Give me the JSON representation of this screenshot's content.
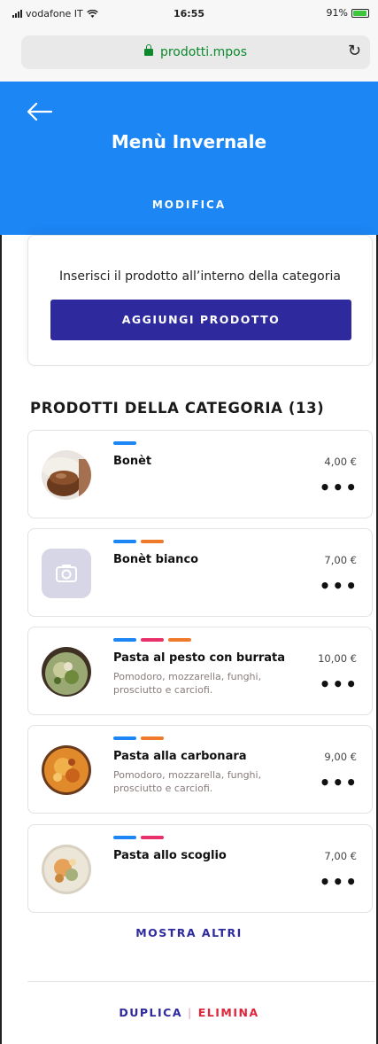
{
  "status_bar": {
    "carrier": "vodafone IT",
    "time": "16:55",
    "battery": "91%",
    "battery_level": 0.91,
    "colors": {
      "battery": "#3cc73c"
    }
  },
  "browser": {
    "url": "prodotti.mpos",
    "lock_icon": "lock-icon",
    "reload_icon": "reload-icon"
  },
  "header": {
    "title": "Menù Invernale",
    "modify_label": "MODIFICA",
    "back_icon": "back-arrow-icon",
    "background": "#1c86f5"
  },
  "add_card": {
    "text": "Inserisci il prodotto all’interno della categoria",
    "button_label": "AGGIUNGI PRODOTTO",
    "button_color": "#2e2a9e"
  },
  "products_section": {
    "title": "PRODOTTI DELLA CATEGORIA (13)"
  },
  "tag_colors": {
    "blue": "#1c86f5",
    "orange": "#f07a2c",
    "pink": "#e8306a"
  },
  "products": [
    {
      "name": "Bonèt",
      "price": "4,00 €",
      "description": "",
      "tags": [
        "blue"
      ],
      "image": "bonet-photo"
    },
    {
      "name": "Bonèt bianco",
      "price": "7,00 €",
      "description": "",
      "tags": [
        "blue",
        "orange"
      ],
      "image": "camera-placeholder-icon"
    },
    {
      "name": "Pasta al pesto con burrata",
      "price": "10,00 €",
      "description": "Pomodoro, mozzarella, funghi, prosciutto e carciofi.",
      "tags": [
        "blue",
        "pink",
        "orange"
      ],
      "image": "pesto-photo"
    },
    {
      "name": "Pasta alla carbonara",
      "price": "9,00 €",
      "description": "Pomodoro, mozzarella, funghi, prosciutto e carciofi.",
      "tags": [
        "blue",
        "orange"
      ],
      "image": "carbonara-photo"
    },
    {
      "name": "Pasta allo scoglio",
      "price": "7,00 €",
      "description": "",
      "tags": [
        "blue",
        "pink"
      ],
      "image": "scoglio-photo"
    }
  ],
  "more_icon": "more-dots-icon",
  "show_more_label": "MOSTRA ALTRI",
  "footer": {
    "duplicate_label": "DUPLICA",
    "separator": "|",
    "delete_label": "ELIMINA"
  }
}
